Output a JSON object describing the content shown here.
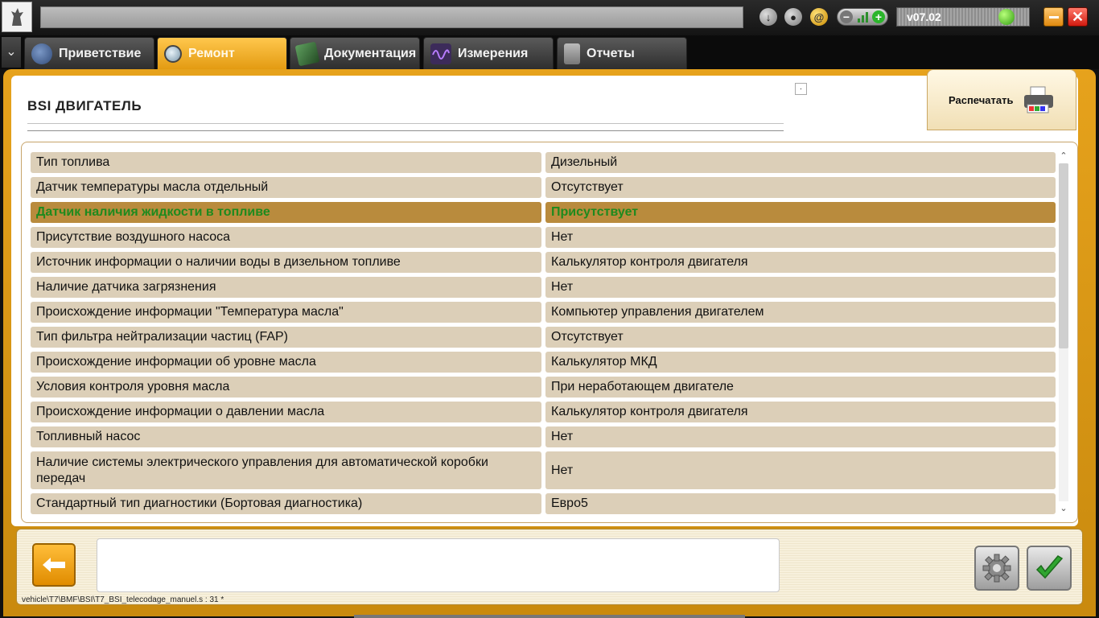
{
  "window": {
    "version": "v07.02",
    "topbar_icons": [
      "download-icon",
      "user-icon",
      "at-icon",
      "signal-strength-icon"
    ]
  },
  "tabs": [
    {
      "label": "Приветствие",
      "icon": "globe-icon",
      "active": false
    },
    {
      "label": "Ремонт",
      "icon": "magnifier-icon",
      "active": true
    },
    {
      "label": "Документация",
      "icon": "book-icon",
      "active": false
    },
    {
      "label": "Измерения",
      "icon": "waveform-icon",
      "active": false
    },
    {
      "label": "Отчеты",
      "icon": "report-icon",
      "active": false
    }
  ],
  "page": {
    "title": "BSI  ДВИГАТЕЛЬ",
    "print_label": "Распечатать",
    "tiny_box_label": "·"
  },
  "table": {
    "rows": [
      {
        "param": "Тип топлива",
        "value": "Дизельный"
      },
      {
        "param": "Датчик температуры масла отдельный",
        "value": "Отсутствует"
      },
      {
        "param": "Датчик наличия жидкости в топливе",
        "value": "Присутствует",
        "highlighted": true
      },
      {
        "param": "Присутствие воздушного насоса",
        "value": "Нет"
      },
      {
        "param": "Источник информации о наличии воды в дизельном топливе",
        "value": "Калькулятор контроля двигателя"
      },
      {
        "param": "Наличие датчика загрязнения",
        "value": "Нет"
      },
      {
        "param": "Происхождение информации \"Температура масла\"",
        "value": "Компьютер управления двигателем"
      },
      {
        "param": "Тип фильтра нейтрализации частиц (FAP)",
        "value": "Отсутствует"
      },
      {
        "param": "Происхождение информации об уровне масла",
        "value": "Калькулятор МКД"
      },
      {
        "param": "Условия контроля уровня масла",
        "value": "При неработающем двигателе"
      },
      {
        "param": "Происхождение информации о давлении масла",
        "value": "Калькулятор контроля двигателя"
      },
      {
        "param": "Топливный насос",
        "value": "Нет"
      },
      {
        "param": "Наличие системы электрического управления для автоматической коробки передач",
        "value": "Нет"
      },
      {
        "param": "Стандартный тип диагностики (Бортовая диагностика)",
        "value": "Евро5"
      }
    ]
  },
  "footer": {
    "status_path": "vehicle\\T7\\BMF\\BSI\\T7_BSI_telecodage_manuel.s : 31 *",
    "message": ""
  },
  "colors": {
    "accent": "#e6a21c",
    "row_bg": "#dccfb8",
    "row_highlight_bg": "#b98b3d",
    "row_highlight_text": "#1e8a1e"
  }
}
